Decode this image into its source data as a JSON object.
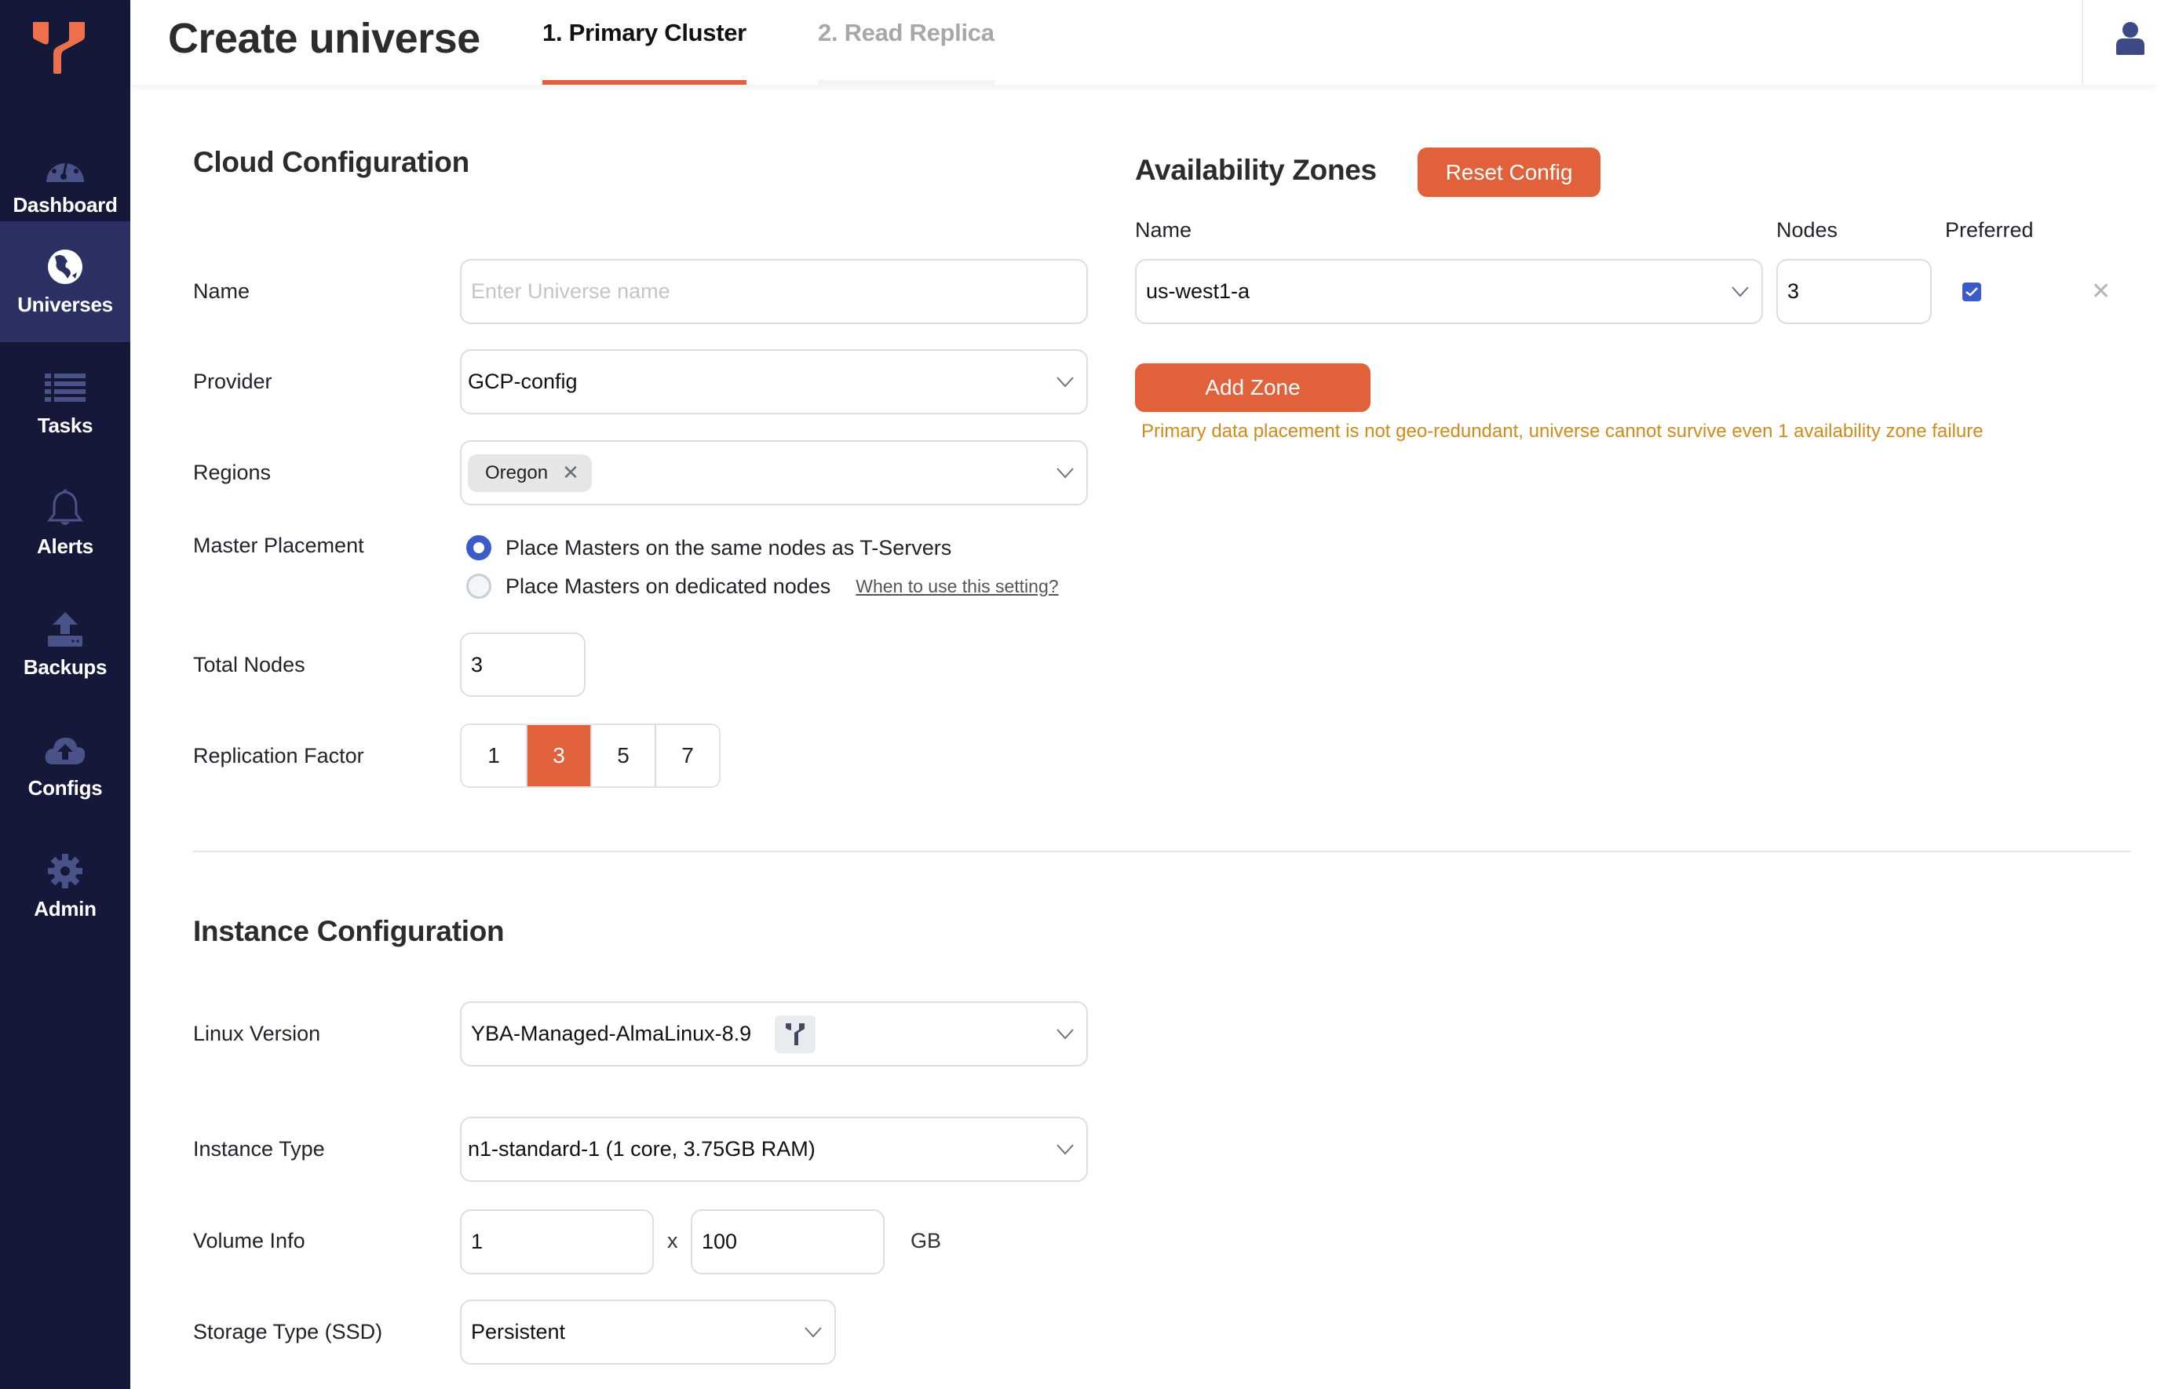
{
  "sidebar": {
    "items": [
      {
        "label": "Dashboard",
        "icon": "dashboard-gauge-icon",
        "active": false
      },
      {
        "label": "Universes",
        "icon": "globe-icon",
        "active": true
      },
      {
        "label": "Tasks",
        "icon": "list-icon",
        "active": false
      },
      {
        "label": "Alerts",
        "icon": "bell-icon",
        "active": false
      },
      {
        "label": "Backups",
        "icon": "upload-icon",
        "active": false
      },
      {
        "label": "Configs",
        "icon": "cloud-upload-icon",
        "active": false
      },
      {
        "label": "Admin",
        "icon": "gear-icon",
        "active": false
      }
    ]
  },
  "header": {
    "title": "Create universe",
    "tabs": [
      {
        "label": "1. Primary Cluster",
        "active": true
      },
      {
        "label": "2. Read Replica",
        "active": false
      }
    ]
  },
  "cloud": {
    "title": "Cloud Configuration",
    "name_label": "Name",
    "name_value": "",
    "name_placeholder": "Enter Universe name",
    "provider_label": "Provider",
    "provider_value": "GCP-config",
    "regions_label": "Regions",
    "regions": [
      "Oregon"
    ],
    "master_label": "Master Placement",
    "master_options": [
      {
        "label": "Place Masters on the same nodes as T-Servers",
        "selected": true
      },
      {
        "label": "Place Masters on dedicated nodes",
        "selected": false
      }
    ],
    "master_help": "When to use this setting?",
    "total_nodes_label": "Total Nodes",
    "total_nodes_value": "3",
    "rf_label": "Replication Factor",
    "rf_options": [
      "1",
      "3",
      "5",
      "7"
    ],
    "rf_selected": "3"
  },
  "zones": {
    "title": "Availability Zones",
    "reset_label": "Reset Config",
    "col_name": "Name",
    "col_nodes": "Nodes",
    "col_preferred": "Preferred",
    "rows": [
      {
        "name": "us-west1-a",
        "nodes": "3",
        "preferred": true
      }
    ],
    "add_label": "Add Zone",
    "warning": "Primary data placement is not geo-redundant, universe cannot survive even 1 availability zone failure"
  },
  "instance": {
    "title": "Instance Configuration",
    "linux_label": "Linux Version",
    "linux_value": "YBA-Managed-AlmaLinux-8.9",
    "type_label": "Instance Type",
    "type_value": "n1-standard-1 (1 core, 3.75GB RAM)",
    "volume_label": "Volume Info",
    "volume_count": "1",
    "volume_sep": "x",
    "volume_size": "100",
    "volume_unit": "GB",
    "storage_label": "Storage Type (SSD)",
    "storage_value": "Persistent"
  },
  "colors": {
    "accent": "#e0613a",
    "sidebar_bg": "#151838",
    "sidebar_active": "#2b3263",
    "icon_color": "#4a5388",
    "warning": "#d08b1a",
    "primary_blue": "#3b5bc8"
  }
}
